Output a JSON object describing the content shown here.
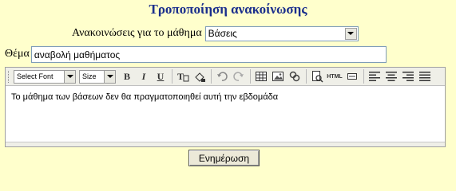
{
  "page": {
    "title": "Τροποποίηση ανακοίνωσης",
    "title_color": "#1a2e8c",
    "background": "#ffffcc"
  },
  "course": {
    "label": "Ανακοινώσεις για το μάθημα",
    "selected": "Βάσεις"
  },
  "subject": {
    "label": "Θέμα",
    "value": "αναβολή μαθήματος"
  },
  "toolbar": {
    "font_select": "Select Font",
    "size_select": "Size",
    "bold_label": "B",
    "italic_label": "I",
    "underline_label": "U",
    "html_label": "HTML",
    "icons": [
      "bold-icon",
      "italic-icon",
      "underline-icon",
      "text-color-icon",
      "highlight-icon",
      "undo-icon",
      "redo-icon",
      "table-icon",
      "image-icon",
      "link-icon",
      "preview-icon",
      "html-icon",
      "textarea-icon",
      "align-left-icon",
      "align-center-icon",
      "align-right-icon",
      "align-justify-icon"
    ]
  },
  "editor": {
    "content": "Το μάθημα των βάσεων δεν θα πραγματοποιηθεί αυτή την εβδομάδα"
  },
  "submit": {
    "label": "Ενημέρωση"
  }
}
